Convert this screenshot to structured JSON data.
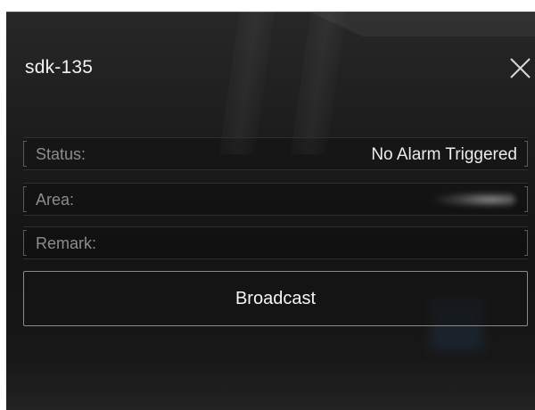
{
  "dialog": {
    "title": "sdk-135",
    "close_icon": "close-icon"
  },
  "fields": [
    {
      "label": "Status:",
      "value": "No Alarm Triggered"
    },
    {
      "label": "Area:",
      "value_redacted": true
    },
    {
      "label": "Remark:",
      "value": ""
    }
  ],
  "actions": {
    "broadcast_label": "Broadcast"
  },
  "colors": {
    "background": "#1a1a1a",
    "text_primary": "#f2f2f2",
    "text_label": "#8c8c8c",
    "button_border": "#8a8a8a"
  }
}
